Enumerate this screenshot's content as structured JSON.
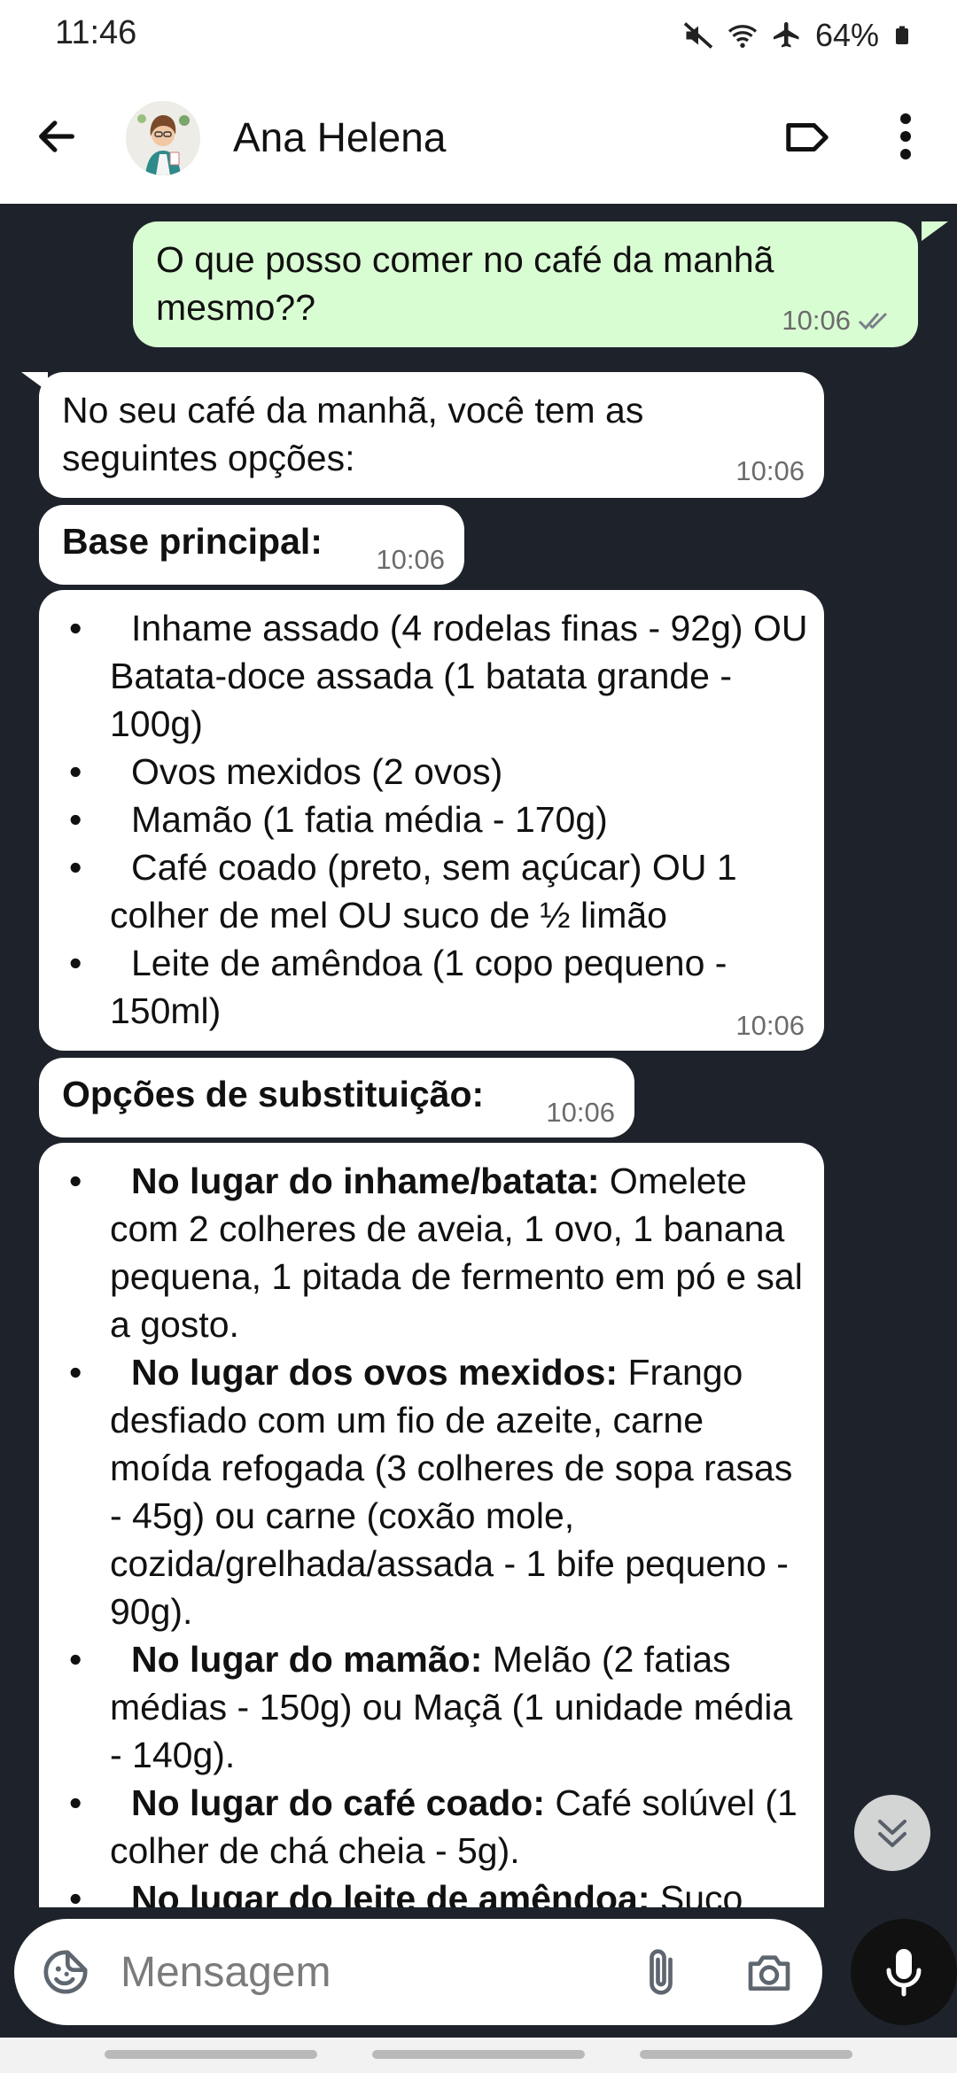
{
  "status_bar": {
    "time": "11:46",
    "battery": "64%"
  },
  "header": {
    "contact_name": "Ana Helena"
  },
  "messages": [
    {
      "direction": "out",
      "text_lines": [
        "O que posso comer no café da manhã",
        "mesmo??"
      ],
      "time": "10:06"
    },
    {
      "direction": "in",
      "text_lines": [
        "No seu café da manhã, você tem as",
        "seguintes opções:"
      ],
      "time": "10:06"
    },
    {
      "direction": "in",
      "heading": "Base principal:",
      "time": "10:06"
    },
    {
      "direction": "in",
      "time": "10:06",
      "items": [
        "Inhame assado (4 rodelas finas - 92g) OU Batata-doce assada (1 batata grande - 100g)",
        "Ovos mexidos (2 ovos)",
        "Mamão (1 fatia média - 170g)",
        "Café coado (preto, sem açúcar) OU 1 colher de mel OU suco de ½ limão",
        "Leite de amêndoa (1 copo pequeno - 150ml)"
      ]
    },
    {
      "direction": "in",
      "heading": "Opções de substituição:",
      "time": "10:06"
    },
    {
      "direction": "in",
      "items": [
        {
          "bold": "No lugar do inhame/batata:",
          "text": " Omelete com 2 colheres de aveia, 1 ovo, 1 banana pequena, 1 pitada de fermento em pó e sal a gosto."
        },
        {
          "bold": "No lugar dos ovos mexidos:",
          "text": " Frango desfiado com um fio de azeite, carne moída refogada (3 colheres de sopa rasas - 45g) ou carne (coxão mole, cozida/grelhada/assada - 1 bife pequeno - 90g)."
        },
        {
          "bold": "No lugar do mamão:",
          "text": " Melão (2 fatias médias - 150g) ou Maçã (1 unidade média - 140g)."
        },
        {
          "bold": "No lugar do café coado:",
          "text": " Café solúvel (1 colher de chá cheia - 5g)."
        },
        {
          "bold": "No lugar do leite de amêndoa:",
          "text": " Suco"
        }
      ]
    }
  ],
  "composer": {
    "placeholder": "Mensagem"
  },
  "colors": {
    "chat_background": "#1e232b",
    "outgoing_bubble": "#d9fdd3",
    "incoming_bubble": "#ffffff",
    "read_ticks": "#7a8088"
  }
}
